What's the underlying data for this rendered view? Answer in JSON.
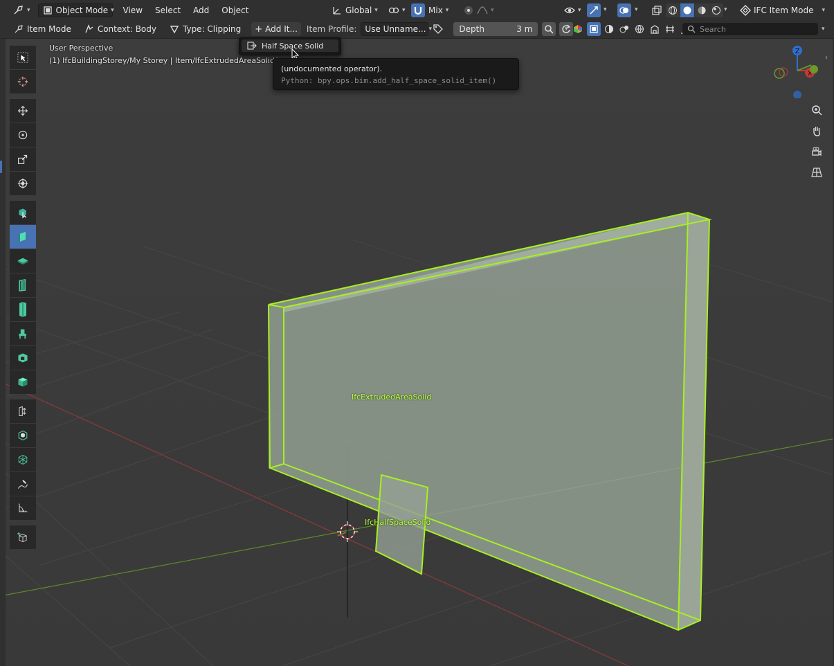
{
  "header": {
    "mode": "Object Mode",
    "menus": [
      "View",
      "Select",
      "Add",
      "Object"
    ],
    "transform_orientation": "Global",
    "snap_mode": "Mix",
    "ifc_mode": "IFC Item Mode"
  },
  "tool_header": {
    "item_mode": "Item Mode",
    "context": "Context: Body",
    "type": "Type: Clipping",
    "add_item": "Add It...",
    "item_profile_label": "Item Profile:",
    "item_profile_value": "Use Unname...",
    "depth_label": "Depth",
    "depth_value": "3 m",
    "search_placeholder": "Search"
  },
  "viewport": {
    "perspective": "User Perspective",
    "context_path": "(1) IfcBuildingStorey/My Storey | Item/IfcExtrudedAreaSolid/",
    "object_labels": {
      "extruded": "IfcExtrudedAreaSolid",
      "halfspace": "IfcHalfSpaceSolid"
    },
    "gizmo_axes": {
      "z": "Z",
      "x": "X"
    }
  },
  "popup": {
    "item_label": "Half Space Solid"
  },
  "tooltip": {
    "description": "(undocumented operator).",
    "python": "Python: bpy.ops.bim.add_half_space_solid_item()"
  },
  "colors": {
    "accent": "#4772b3",
    "selection": "#a0ff20",
    "x_axis": "#b43c3c",
    "y_axis": "#6b9a2a",
    "z_axis": "#2f6fd0"
  },
  "icons": {
    "toolbar": [
      "select-box-icon",
      "cursor-icon",
      "move-icon",
      "rotate-icon",
      "scale-icon",
      "transform-icon",
      "ifc-select-icon",
      "wall-icon",
      "slab-icon",
      "door-icon",
      "column-icon",
      "furniture-icon",
      "opening-icon",
      "cube-icon",
      "extrude-icon",
      "bim-object-icon",
      "mesh-icon",
      "annotate-icon",
      "measure-icon",
      "add-cube-icon"
    ]
  }
}
